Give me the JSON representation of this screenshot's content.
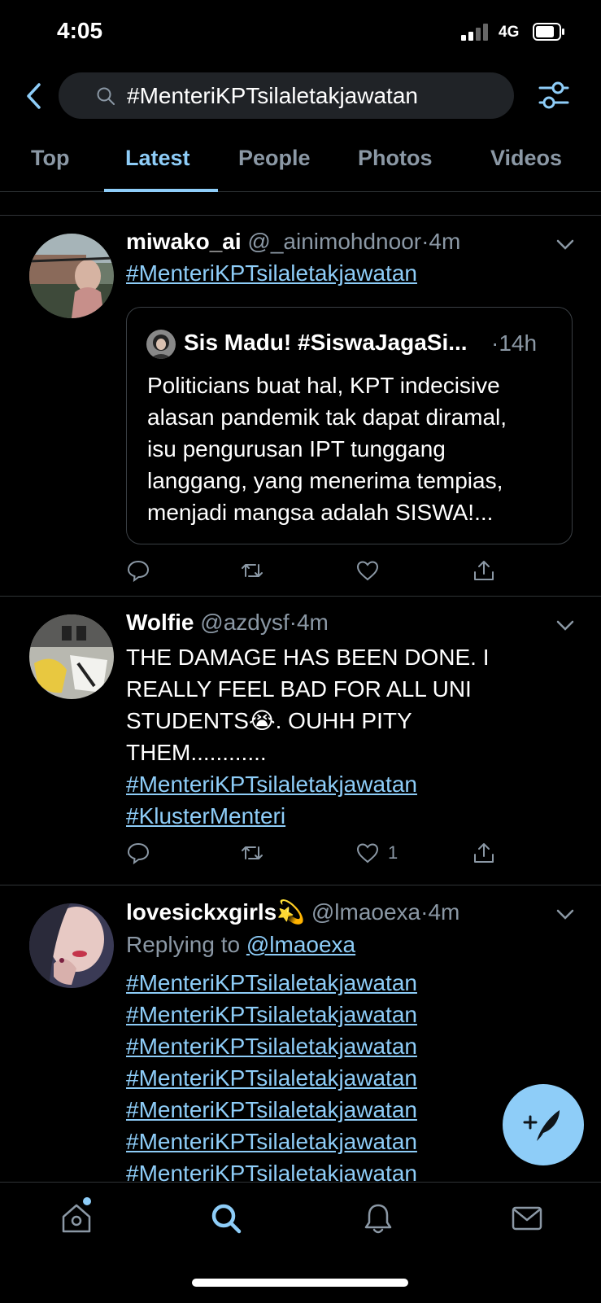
{
  "status_bar": {
    "time": "4:05",
    "network": "4G"
  },
  "search": {
    "query": "#MenteriKPTsilaletakjawatan"
  },
  "tabs": [
    {
      "label": "Top"
    },
    {
      "label": "Latest",
      "active": true
    },
    {
      "label": "People"
    },
    {
      "label": "Photos"
    },
    {
      "label": "Videos"
    }
  ],
  "tweets": [
    {
      "name": "miwako_ai",
      "handle": "@_ainimohdnoor",
      "separator": "·",
      "time": "4m",
      "hashtag": "#MenteriKPTsilaletakjawatan",
      "quote": {
        "name": "Sis Madu! #SiswaJagaSi...",
        "time": "·14h",
        "lines": [
          "Politicians buat hal, KPT indecisive",
          "alasan pandemik tak dapat diramal,",
          "isu pengurusan IPT tunggang",
          "langgang, yang menerima tempias,",
          "menjadi mangsa adalah SISWA!..."
        ]
      }
    },
    {
      "name": "Wolfie",
      "handle": "@azdysf",
      "separator": "·",
      "time": "4m",
      "lines": [
        "THE DAMAGE HAS BEEN DONE. I",
        "REALLY FEEL BAD FOR ALL UNI",
        "STUDENTS😭. OUHH PITY",
        "THEM............"
      ],
      "hashtags": [
        "#MenteriKPTsilaletakjawatan",
        "#KlusterMenteri"
      ],
      "like_count": "1"
    },
    {
      "name": "lovesickxgirls💫",
      "handle": "@lmaoexa",
      "separator": "·",
      "time": "4m",
      "replying_to_label": "Replying to",
      "replying_to_handle": "@lmaoexa",
      "hashtags": [
        "#MenteriKPTsilaletakjawatan",
        "#MenteriKPTsilaletakjawatan",
        "#MenteriKPTsilaletakjawatan",
        "#MenteriKPTsilaletakjawatan",
        "#MenteriKPTsilaletakjawatan",
        "#MenteriKPTsilaletakjawatan",
        "#MenteriKPTsilaletakjawatan"
      ]
    }
  ],
  "colors": {
    "accent": "#8ecdf8",
    "muted": "#8b98a5",
    "divider": "#2f3336",
    "background": "#000000"
  },
  "icons": {
    "back": "chevron-left-icon",
    "search": "search-icon",
    "filter": "filter-icon",
    "reply": "reply-icon",
    "retweet": "retweet-icon",
    "like": "heart-icon",
    "share": "share-icon",
    "compose": "compose-icon",
    "home": "home-icon",
    "explore": "search-icon",
    "notifications": "bell-icon",
    "messages": "mail-icon"
  }
}
